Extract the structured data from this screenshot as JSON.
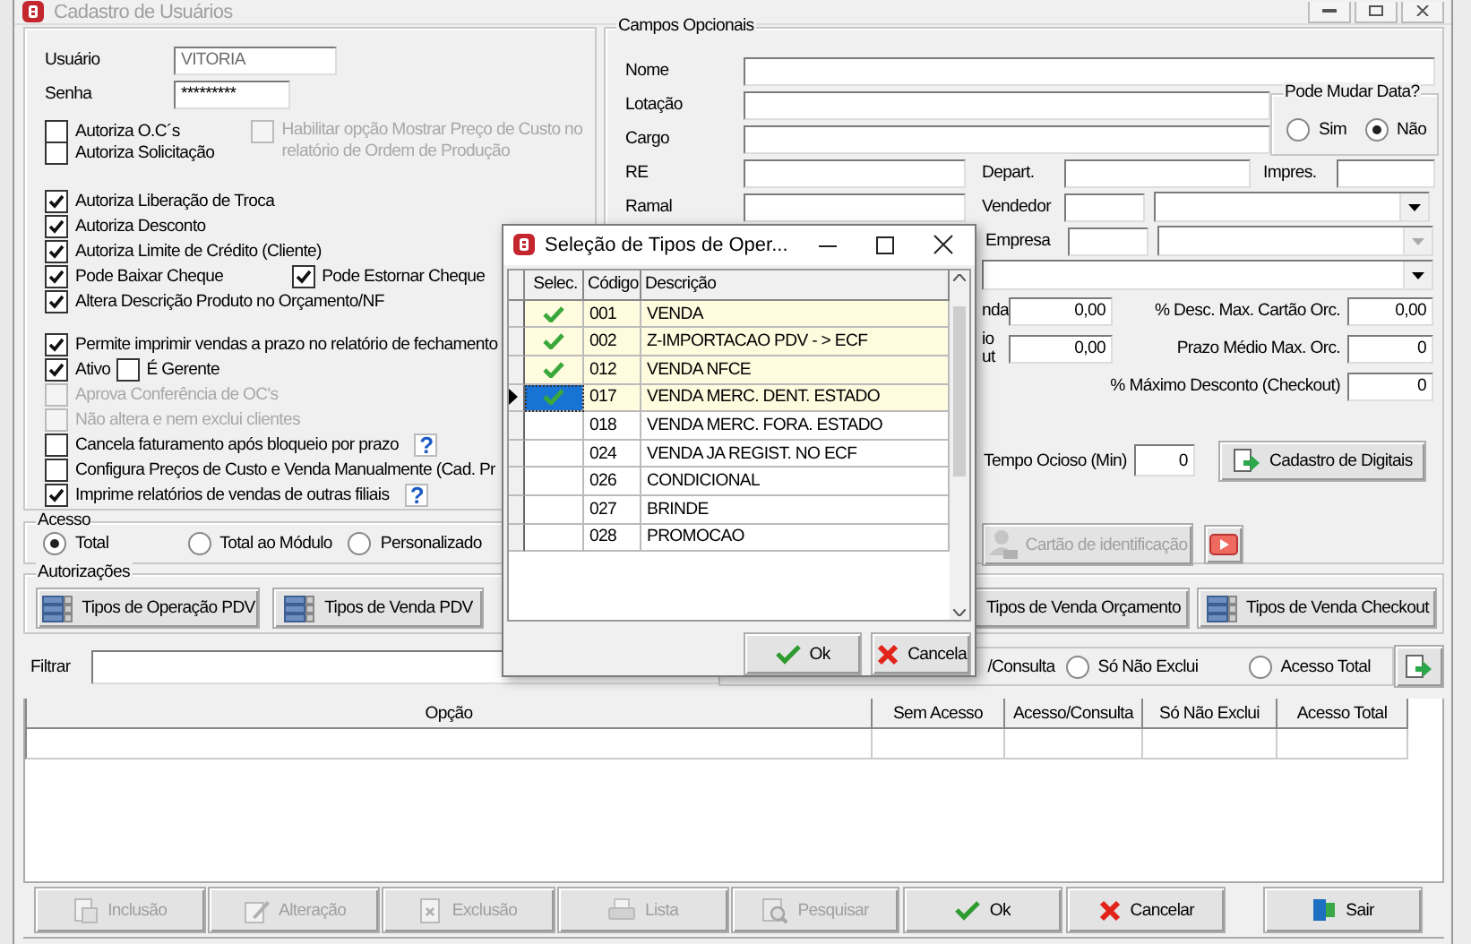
{
  "window": {
    "title": "Cadastro de Usuários"
  },
  "login": {
    "user_label": "Usuário",
    "user_value": "VITORIA",
    "password_label": "Senha",
    "password_value": "*********"
  },
  "option_sections": [
    {
      "rows": [
        [
          {
            "label": "Autoriza O.C´s",
            "checked": false,
            "disabled": false
          },
          {
            "label": "Habilitar opção Mostrar Preço de Custo no relatório de Ordem de Produção",
            "checked": false,
            "disabled": true
          }
        ],
        [
          {
            "label": "Autoriza Solicitação",
            "checked": false,
            "disabled": false
          }
        ]
      ]
    },
    {
      "rows": [
        [
          {
            "label": "Autoriza Liberação de Troca",
            "checked": true,
            "disabled": false
          }
        ],
        [
          {
            "label": "Autoriza Desconto",
            "checked": true,
            "disabled": false
          }
        ],
        [
          {
            "label": "Autoriza Limite de Crédito (Cliente)",
            "checked": true,
            "disabled": false
          }
        ],
        [
          {
            "label": "Pode Baixar Cheque",
            "checked": true,
            "disabled": false
          },
          {
            "label": "Pode Estornar Cheque",
            "checked": true,
            "disabled": false
          }
        ],
        [
          {
            "label": "Altera Descrição Produto no Orçamento/NF",
            "checked": true,
            "disabled": false
          }
        ]
      ]
    },
    {
      "rows": [
        [
          {
            "label": "Permite imprimir vendas a prazo no relatório de fechamento",
            "checked": true,
            "disabled": false
          }
        ],
        [
          {
            "label": "Ativo",
            "checked": true,
            "disabled": false
          },
          {
            "label": "É Gerente",
            "checked": false,
            "disabled": false
          }
        ],
        [
          {
            "label": "Aprova Conferência de OC's",
            "checked": false,
            "disabled": true
          }
        ],
        [
          {
            "label": "Não altera e nem exclui clientes",
            "checked": false,
            "disabled": true
          }
        ],
        [
          {
            "label": "Cancela faturamento após bloqueio por prazo",
            "checked": false,
            "disabled": false,
            "help": "?"
          }
        ],
        [
          {
            "label": "Configura Preços de Custo e Venda Manualmente (Cad. Pr",
            "checked": false,
            "disabled": false
          }
        ],
        [
          {
            "label": "Imprime relatórios de vendas de outras filiais",
            "checked": true,
            "disabled": false,
            "help": "?"
          }
        ]
      ]
    }
  ],
  "access": {
    "legend": "Acesso",
    "options": [
      {
        "label": "Total",
        "selected": true
      },
      {
        "label": "Total ao Módulo",
        "selected": false
      },
      {
        "label": "Personalizado",
        "selected": false
      }
    ]
  },
  "optional_fields": {
    "legend": "Campos Opcionais",
    "labels": {
      "nome": "Nome",
      "lotacao": "Lotação",
      "cargo": "Cargo",
      "re": "RE",
      "ramal": "Ramal",
      "depart": "Depart.",
      "impres": "Impres.",
      "vendedor": "Vendedor",
      "empresa": "Empresa"
    },
    "empresa_select": {
      "disabled": true
    },
    "pode_mudar_data": {
      "legend": "Pode Mudar Data?",
      "options": [
        {
          "label": "Sim",
          "selected": false
        },
        {
          "label": "Não",
          "selected": true
        }
      ]
    },
    "left_values": [
      {
        "label": [
          "nda"
        ],
        "value": "0,00"
      },
      {
        "label": [
          "io",
          "ut"
        ],
        "value": "0,00"
      }
    ],
    "right_values": [
      {
        "label": "% Desc. Max. Cartão Orc.",
        "value": "0,00"
      },
      {
        "label": "Prazo Médio Max. Orc.",
        "value": "0"
      },
      {
        "label": "% Máximo Desconto (Checkout)",
        "value": "0"
      }
    ],
    "idle": {
      "label": "Tempo Ocioso (Min)",
      "value": "0"
    },
    "fingerprint_button": "Cadastro de Digitais",
    "card_button": {
      "label": "Cartão de identificação",
      "disabled": true
    }
  },
  "authorizations": {
    "legend": "Autorizações",
    "buttons": [
      "Tipos de Operação PDV",
      "Tipos de Venda PDV",
      "Tipos de Venda Orçamento",
      "Tipos de Venda Checkout"
    ]
  },
  "filter": {
    "label": "Filtrar",
    "options": [
      {
        "kind": "text",
        "label": "/Consulta"
      },
      {
        "kind": "radio",
        "label": "Só Não Exclui",
        "selected": false
      },
      {
        "kind": "radio",
        "label": "Acesso Total",
        "selected": false
      }
    ]
  },
  "table": {
    "columns": [
      "Opção",
      "Sem Acesso",
      "Acesso/Consulta",
      "Só Não Exclui",
      "Acesso Total"
    ]
  },
  "toolbar": [
    {
      "label": "Inclusão",
      "kind": "insert",
      "disabled": true
    },
    {
      "label": "Alteração",
      "kind": "edit",
      "disabled": true
    },
    {
      "label": "Exclusão",
      "kind": "delete",
      "disabled": true
    },
    {
      "label": "Lista",
      "kind": "print",
      "disabled": true
    },
    {
      "label": "Pesquisar",
      "kind": "search",
      "disabled": true
    }
  ],
  "actions": [
    {
      "label": "Ok",
      "kind": "ok"
    },
    {
      "label": "Cancelar",
      "kind": "cancel"
    },
    {
      "label": "Sair",
      "kind": "exit"
    }
  ],
  "dialog": {
    "title": "Seleção de Tipos de Oper...",
    "columns": [
      "Selec.",
      "Código",
      "Descrição"
    ],
    "rows": [
      {
        "code": "001",
        "description": "VENDA",
        "checked": true,
        "current": false
      },
      {
        "code": "002",
        "description": "Z-IMPORTACAO PDV - > ECF",
        "checked": true,
        "current": false
      },
      {
        "code": "012",
        "description": "VENDA NFCE",
        "checked": true,
        "current": false
      },
      {
        "code": "017",
        "description": "VENDA MERC. DENT. ESTADO",
        "checked": true,
        "current": true
      },
      {
        "code": "018",
        "description": "VENDA MERC. FORA. ESTADO",
        "checked": false,
        "current": false
      },
      {
        "code": "024",
        "description": "VENDA JA REGIST. NO ECF",
        "checked": false,
        "current": false
      },
      {
        "code": "026",
        "description": "CONDICIONAL",
        "checked": false,
        "current": false
      },
      {
        "code": "027",
        "description": "BRINDE",
        "checked": false,
        "current": false
      },
      {
        "code": "028",
        "description": "PROMOCAO",
        "checked": false,
        "current": false
      }
    ],
    "buttons": [
      {
        "label": "Ok",
        "kind": "ok"
      },
      {
        "label": "Cancela",
        "kind": "cancel"
      }
    ]
  }
}
